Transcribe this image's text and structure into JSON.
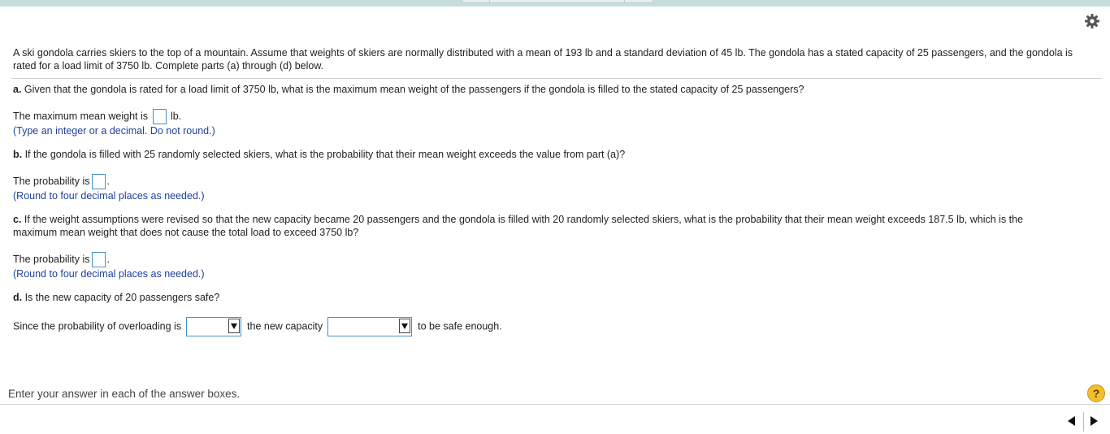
{
  "intro": "A ski gondola carries skiers to the top of a mountain. Assume that weights of skiers are normally distributed with a mean of 193 lb and a standard deviation of 45 lb. The gondola has a stated capacity of 25 passengers, and the gondola is rated for a load limit of 3750 lb. Complete parts (a) through (d) below.",
  "part_a": {
    "label": "a.",
    "question": " Given that the gondola is rated for a load limit of 3750 lb, what is the maximum mean weight of the passengers if the gondola is filled to the stated capacity of 25 passengers?",
    "answer_prefix": "The maximum mean weight is",
    "answer_suffix": "lb.",
    "hint": "(Type an integer or a decimal. Do not round.)"
  },
  "part_b": {
    "label": "b.",
    "question": " If the gondola is filled with 25 randomly selected skiers, what is the probability that their mean weight exceeds the value from part (a)?",
    "answer_prefix": "The probability is",
    "answer_suffix": ".",
    "hint": "(Round to four decimal places as needed.)"
  },
  "part_c": {
    "label": "c.",
    "question": " If the weight assumptions were revised so that the new capacity became 20 passengers and the gondola is filled with 20 randomly selected skiers, what is the probability that their mean weight exceeds 187.5 lb, which is the maximum mean weight that does not cause the total load to exceed 3750 lb?",
    "answer_prefix": "The probability is",
    "answer_suffix": ".",
    "hint": "(Round to four decimal places as needed.)"
  },
  "part_d": {
    "label": "d.",
    "question": " Is the new capacity of 20 passengers safe?",
    "sentence_start": "Since the probability of overloading is",
    "sentence_middle": "the new capacity",
    "sentence_end": "to be safe enough."
  },
  "footer": {
    "instruction": "Enter your answer in each of the answer boxes.",
    "help": "?"
  },
  "icons": {
    "settings": "gear-icon",
    "help": "help-icon",
    "prev": "previous-arrow-icon",
    "next": "next-arrow-icon"
  },
  "colors": {
    "hint_text": "#1f3f9d",
    "input_border": "#4a8fc9",
    "topbar": "#c5ded9",
    "help_badge": "#f3c02b"
  }
}
